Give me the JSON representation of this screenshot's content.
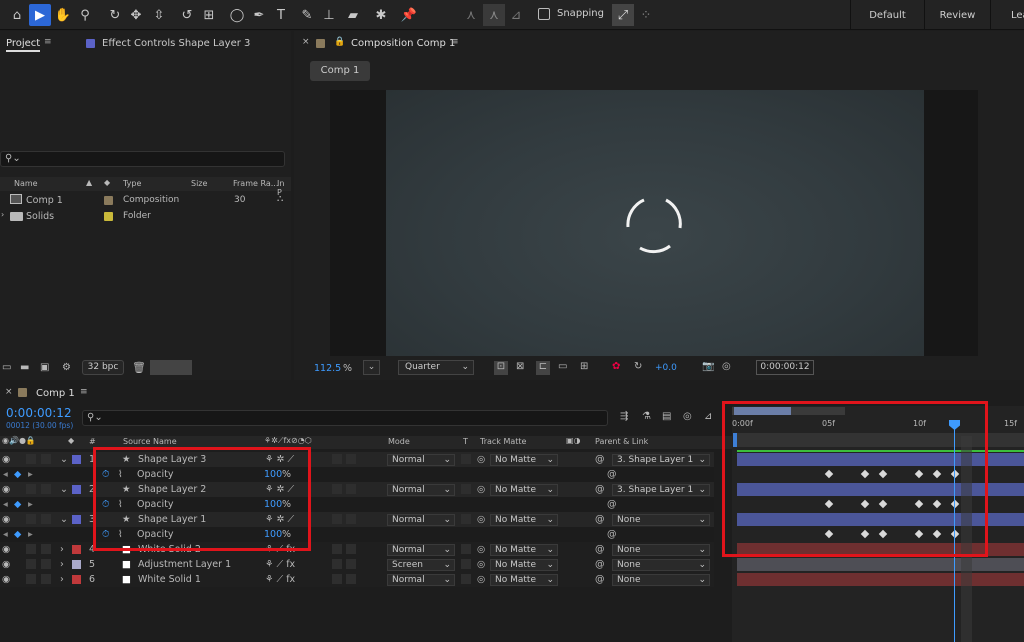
{
  "toolbar": {
    "snapping": "Snapping",
    "workspaces": [
      "Default",
      "Review",
      "Lea"
    ],
    "tools": [
      "home-icon",
      "selection-arrow-icon",
      "hand-icon",
      "zoom-icon",
      "orbit-camera-icon",
      "pan-camera-icon",
      "dolly-camera-icon",
      "rotate-icon",
      "pan-behind-icon",
      "ellipse-icon",
      "pen-icon",
      "type-icon",
      "brush-icon",
      "clone-stamp-icon",
      "eraser-icon",
      "roto-brush-icon",
      "puppet-pin-icon"
    ]
  },
  "project": {
    "tab": "Project",
    "effect_tab": "Effect Controls Shape Layer 3",
    "cols": {
      "name": "Name",
      "type": "Type",
      "size": "Size",
      "fr": "Frame Ra...",
      "inp": "In P"
    },
    "items": [
      {
        "name": "Comp 1",
        "type": "Composition",
        "fr": "30"
      },
      {
        "name": "Solids",
        "type": "Folder",
        "fr": ""
      }
    ],
    "bpc": "32 bpc"
  },
  "comp": {
    "tab": "Composition Comp 1",
    "breadcrumb": "Comp 1",
    "zoom": "112.5",
    "pct": "%",
    "res": "Quarter",
    "exposure": "+0.0",
    "timecode": "0:00:00:12"
  },
  "timeline": {
    "tab": "Comp 1",
    "timecode": "0:00:00:12",
    "sub": "00012 (30.00 fps)",
    "cols": {
      "src": "Source Name",
      "mode": "Mode",
      "t": "T",
      "matte": "Track Matte",
      "parent": "Parent & Link",
      "num": "#"
    },
    "rulers": [
      "0:00f",
      "05f",
      "10f",
      "15f"
    ],
    "layers": [
      {
        "num": "1",
        "name": "Shape Layer 3",
        "color": "#5b62c7",
        "mode": "Normal",
        "matte": "No Matte",
        "parent": "3. Shape Layer 1",
        "prop": "Opacity",
        "val": "100",
        "unit": "%"
      },
      {
        "num": "2",
        "name": "Shape Layer 2",
        "color": "#5b62c7",
        "mode": "Normal",
        "matte": "No Matte",
        "parent": "3. Shape Layer 1",
        "prop": "Opacity",
        "val": "100",
        "unit": "%"
      },
      {
        "num": "3",
        "name": "Shape Layer 1",
        "color": "#5b62c7",
        "mode": "Normal",
        "matte": "No Matte",
        "parent": "None",
        "prop": "Opacity",
        "val": "100",
        "unit": "%"
      },
      {
        "num": "4",
        "name": "White Solid 2",
        "color": "#c0393b",
        "mode": "Normal",
        "matte": "No Matte",
        "parent": "None"
      },
      {
        "num": "5",
        "name": "Adjustment Layer 1",
        "color": "#a9a9c9",
        "mode": "Screen",
        "matte": "No Matte",
        "parent": "None"
      },
      {
        "num": "6",
        "name": "White Solid 1",
        "color": "#c0393b",
        "mode": "Normal",
        "matte": "No Matte",
        "parent": "None"
      }
    ]
  }
}
